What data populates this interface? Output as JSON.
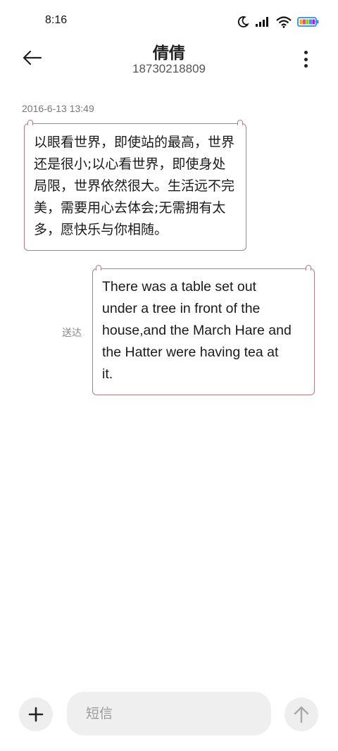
{
  "status_bar": {
    "time": "8:16",
    "icons": [
      "moon-icon",
      "signal-icon",
      "wifi-icon",
      "battery-icon"
    ]
  },
  "header": {
    "contact_name": "倩倩",
    "phone_number": "18730218809",
    "back_icon": "back-arrow-icon",
    "more_icon": "more-vertical-icon"
  },
  "conversation": {
    "timestamp": "2016-6-13 13:49",
    "messages": [
      {
        "direction": "incoming",
        "lines": [
          "以眼看世界，即使站的最高，世界",
          "还是很小;以心看世界，即使身处",
          "局限，世界依然很大。生活远不完",
          "美，需要用心去体会;无需拥有太",
          "多，愿快乐与你相随。"
        ]
      },
      {
        "direction": "outgoing",
        "status": "送达",
        "lines": [
          "There was a table set out",
          "under a tree in front of the",
          "house,and the March Hare and",
          "the Hatter were having tea at",
          "it."
        ]
      }
    ]
  },
  "composer": {
    "input_value": "",
    "placeholder": "短信",
    "add_icon": "plus-icon",
    "send_icon": "arrow-up-icon"
  },
  "colors": {
    "bubble_border": "#b97a80",
    "input_bg": "#efefef",
    "button_bg": "#eeeeee"
  }
}
